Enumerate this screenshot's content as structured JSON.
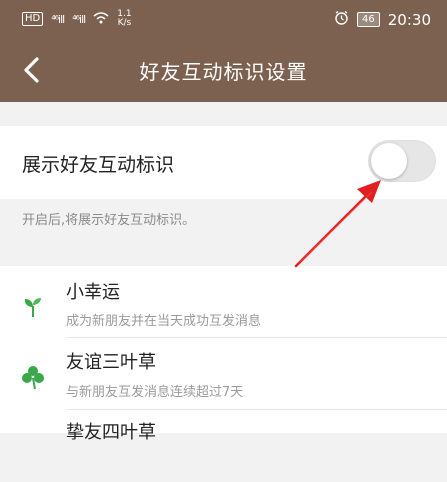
{
  "status_bar": {
    "hd": "HD",
    "hd_sub": "B",
    "signal1": "⁴⁶ill",
    "signal2": "⁴⁶ill",
    "speed_value": "1.1",
    "speed_unit": "K/s",
    "battery": "46",
    "time": "20:30"
  },
  "header": {
    "title": "好友互动标识设置"
  },
  "setting": {
    "label": "展示好友互动标识",
    "enabled": false,
    "hint": "开启后,将展示好友互动标识。"
  },
  "badges": [
    {
      "name": "小幸运",
      "desc": "成为新朋友并在当天成功互发消息",
      "icon": "sprout-icon"
    },
    {
      "name": "友谊三叶草",
      "desc": "与新朋友互发消息连续超过7天",
      "icon": "clover-three-icon"
    },
    {
      "name": "挚友四叶草",
      "desc": "",
      "icon": "clover-four-icon"
    }
  ],
  "colors": {
    "header": "#7d6150",
    "icon_green": "#3aa84a",
    "annotation_arrow": "#e02020"
  }
}
